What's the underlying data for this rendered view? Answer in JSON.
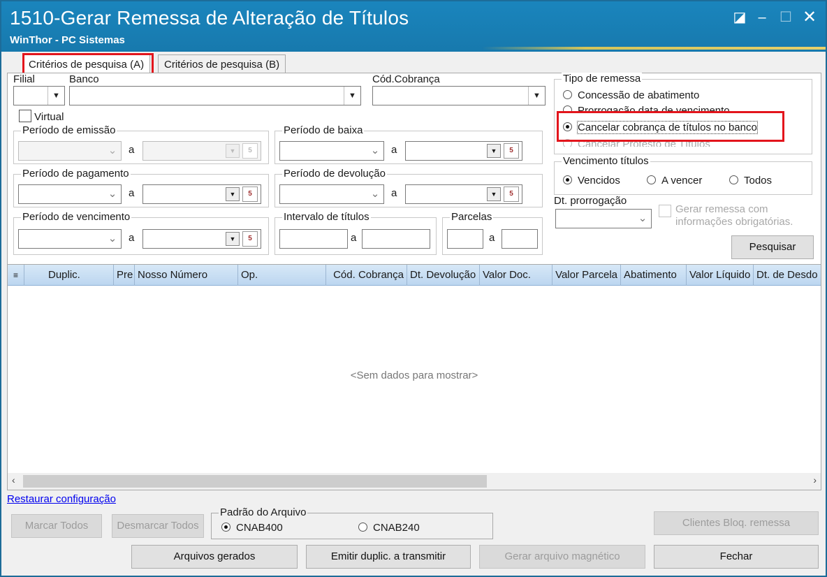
{
  "window": {
    "title": "1510-Gerar Remessa de Alteração de Títulos",
    "subtitle": "WinThor - PC Sistemas"
  },
  "tabs": [
    {
      "label": "Critérios de pesquisa (A)",
      "active": true
    },
    {
      "label": "Critérios de pesquisa (B)",
      "active": false
    }
  ],
  "fields": {
    "filial_label": "Filial",
    "banco_label": "Banco",
    "cod_cobranca_label": "Cód.Cobrança",
    "virtual_label": "Virtual",
    "a_label": "a",
    "periodo_emissao": "Período de emissão",
    "periodo_baixa": "Período de baixa",
    "periodo_pagamento": "Período de pagamento",
    "periodo_devolucao": "Período de devolução",
    "periodo_vencimento": "Período de vencimento",
    "intervalo_titulos": "Intervalo de títulos",
    "parcelas": "Parcelas"
  },
  "tipo_remessa": {
    "title": "Tipo de remessa",
    "options": [
      {
        "label": "Concessão de abatimento",
        "selected": false,
        "enabled": true
      },
      {
        "label": "Prorrogação data de vencimento",
        "selected": false,
        "enabled": true
      },
      {
        "label": "Cancelar cobrança de títulos no banco",
        "selected": true,
        "enabled": true
      },
      {
        "label": "Cancelar Protesto de Títulos",
        "selected": false,
        "enabled": false
      }
    ]
  },
  "vencimento_titulos": {
    "title": "Vencimento títulos",
    "options": [
      {
        "label": "Vencidos",
        "selected": true
      },
      {
        "label": "A vencer",
        "selected": false
      },
      {
        "label": "Todos",
        "selected": false
      }
    ]
  },
  "dt_prorrogacao_label": "Dt. prorrogação",
  "gerar_remessa_label_line1": "Gerar remessa com",
  "gerar_remessa_label_line2": "informações obrigatórias.",
  "pesquisar_label": "Pesquisar",
  "grid": {
    "columns": [
      "Duplic.",
      "Pre",
      "Nosso Número",
      "Op.",
      "Cód. Cobrança",
      "Dt. Devolução",
      "Valor Doc.",
      "Valor Parcela",
      "Abatimento",
      "Valor Líquido",
      "Dt. de Desdo"
    ],
    "empty_text": "<Sem dados para mostrar>"
  },
  "restaurar_label": "Restaurar configuração",
  "buttons": {
    "marcar_todos": "Marcar Todos",
    "desmarcar_todos": "Desmarcar Todos",
    "clientes_bloq": "Clientes Bloq. remessa",
    "arquivos_gerados": "Arquivos gerados",
    "emitir_duplic": "Emitir duplic. a transmitir",
    "gerar_arquivo": "Gerar arquivo magnético",
    "fechar": "Fechar"
  },
  "padrao_arquivo": {
    "title": "Padrão do Arquivo",
    "options": [
      {
        "label": "CNAB400",
        "selected": true
      },
      {
        "label": "CNAB240",
        "selected": false
      }
    ]
  },
  "colors": {
    "titlebar": "#1a85bd",
    "highlight": "#e3151c",
    "grid_header": "#bcd6f0"
  }
}
